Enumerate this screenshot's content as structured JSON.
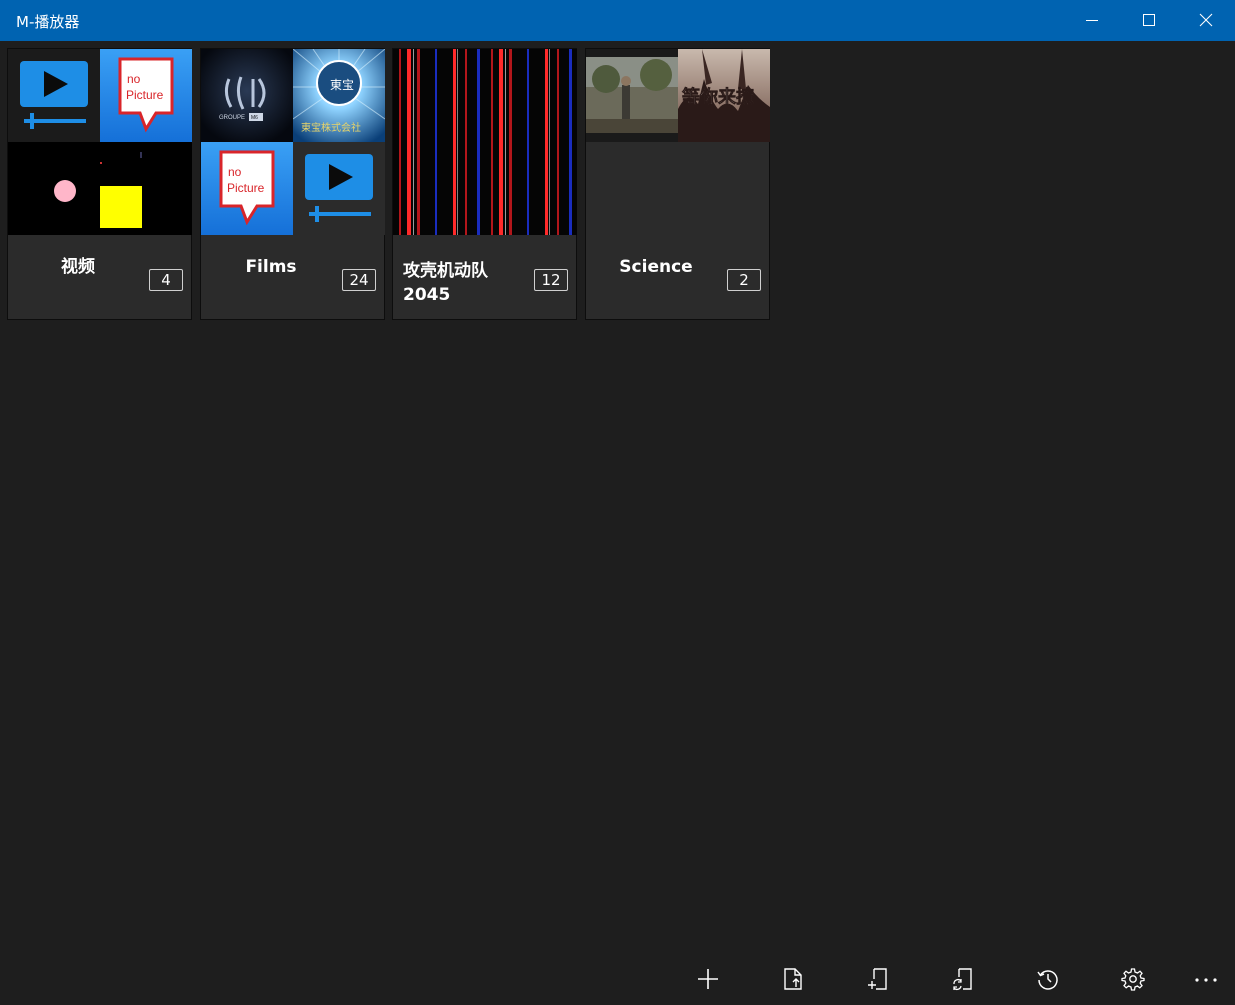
{
  "window": {
    "title": "M-播放器",
    "controls": [
      "minimize-icon",
      "maximize-icon",
      "close-icon"
    ]
  },
  "albums": [
    {
      "name": "视频",
      "count": "4",
      "thumbnails": [
        "play-video-icon",
        "no-picture-icon",
        "pink-dot-frame",
        "yellow-square-frame"
      ]
    },
    {
      "name": "Films",
      "count": "24",
      "thumbnails": [
        "film-logo-frame",
        "studio-logo-frame",
        "no-picture-icon",
        "play-video-icon"
      ]
    },
    {
      "name": "攻壳机动队2045",
      "count": "12",
      "thumbnails": [
        "striped-frame",
        "striped-frame",
        "striped-frame",
        "striped-frame"
      ]
    },
    {
      "name": "Science",
      "count": "2",
      "thumbnails": [
        "outdoor-scene-frame",
        "crowd-scene-frame"
      ]
    }
  ],
  "thumb_text": {
    "no_picture_line1": "no",
    "no_picture_line2": "Picture",
    "film_logo": "GROUPE",
    "film_logo_badge": "M6",
    "studio_caption": "東宝株式会社",
    "studio_seal": "東宝",
    "crowd_caption": "等你来撩"
  },
  "commandbar": [
    {
      "name": "add",
      "icon": "add-icon"
    },
    {
      "name": "open-file",
      "icon": "open-file-icon"
    },
    {
      "name": "add-folder",
      "icon": "add-folder-icon"
    },
    {
      "name": "refresh-library",
      "icon": "refresh-library-icon"
    },
    {
      "name": "history",
      "icon": "history-icon"
    },
    {
      "name": "settings",
      "icon": "gear-icon"
    },
    {
      "name": "more",
      "icon": "more-icon"
    }
  ],
  "colors": {
    "titlebar": "#0063b1",
    "background": "#1e1e1e",
    "tile": "#2b2b2b",
    "play_icon_blue": "#1e8ee6",
    "no_picture_red": "#d9252a"
  }
}
